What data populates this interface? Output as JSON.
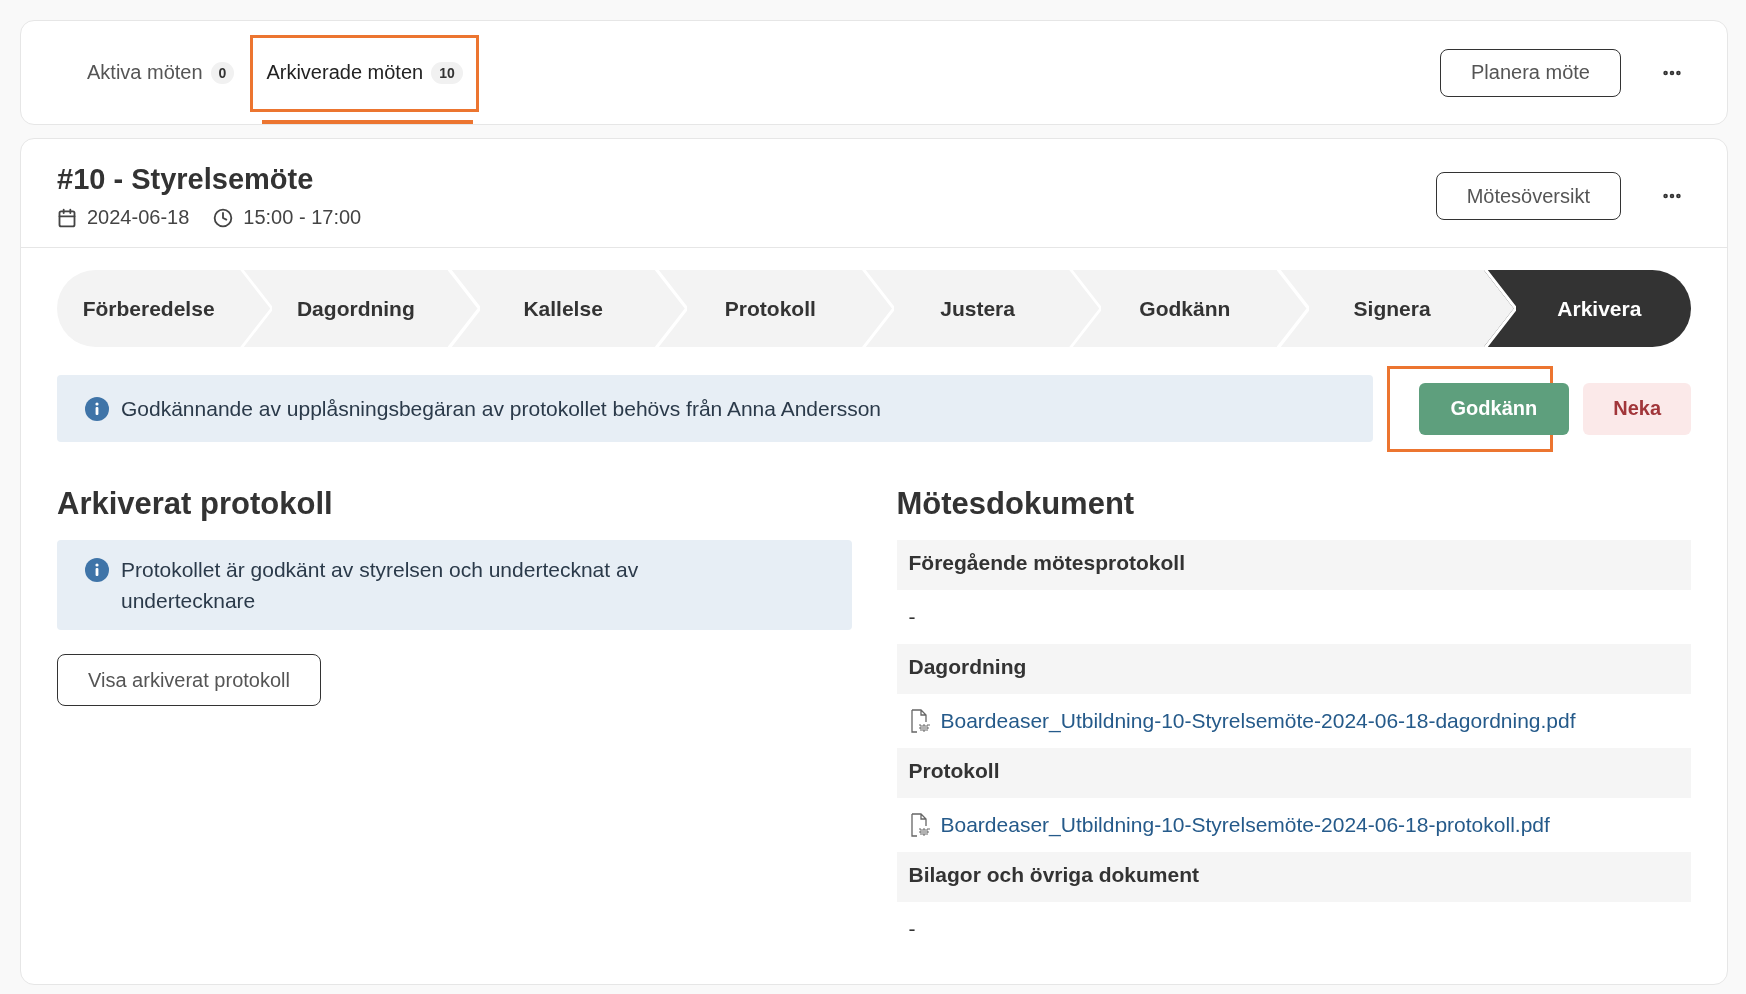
{
  "tabs": [
    {
      "label": "Aktiva möten",
      "count": "0",
      "selected": false,
      "highlighted": false
    },
    {
      "label": "Arkiverade möten",
      "count": "10",
      "selected": true,
      "highlighted": true
    }
  ],
  "header_actions": {
    "primary_button": "Planera möte"
  },
  "meeting": {
    "title": "#10 - Styrelsemöte",
    "date": "2024-06-18",
    "time": "15:00 - 17:00",
    "overview_button": "Mötesöversikt"
  },
  "steps": [
    {
      "label": "Förberedelse",
      "selected": false
    },
    {
      "label": "Dagordning",
      "selected": false
    },
    {
      "label": "Kallelse",
      "selected": false
    },
    {
      "label": "Protokoll",
      "selected": false
    },
    {
      "label": "Justera",
      "selected": false
    },
    {
      "label": "Godkänn",
      "selected": false
    },
    {
      "label": "Signera",
      "selected": false
    },
    {
      "label": "Arkivera",
      "selected": true
    }
  ],
  "approval": {
    "message": "Godkännande av upplåsningsbegäran av protokollet behövs från Anna Andersson",
    "approve_button": {
      "label": "Godkänn",
      "highlighted": true
    },
    "reject_button": "Neka"
  },
  "archived_protocol": {
    "heading": "Arkiverat protokoll",
    "notice": "Protokollet är godkänt av styrelsen och undertecknat av undertecknare",
    "button": "Visa arkiverat protokoll"
  },
  "documents": {
    "heading": "Mötesdokument",
    "sections": [
      {
        "title": "Föregående mötesprotokoll",
        "kind": "empty",
        "value": "-"
      },
      {
        "title": "Dagordning",
        "kind": "file",
        "value": "Boardeaser_Utbildning-10-Styrelsemöte-2024-06-18-dagordning.pdf"
      },
      {
        "title": "Protokoll",
        "kind": "file",
        "value": "Boardeaser_Utbildning-10-Styrelsemöte-2024-06-18-protokoll.pdf"
      },
      {
        "title": "Bilagor och övriga dokument",
        "kind": "empty",
        "value": "-"
      }
    ]
  }
}
